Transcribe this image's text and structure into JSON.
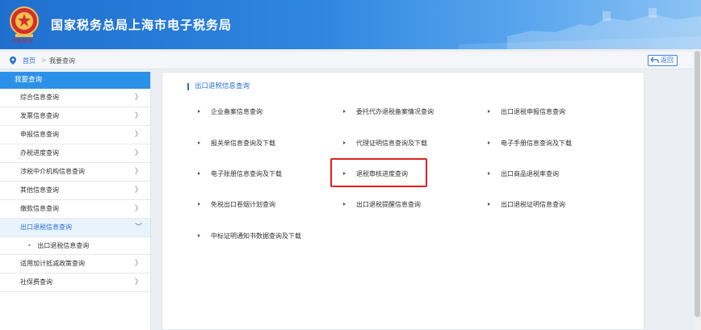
{
  "header": {
    "title": "国家税务总局上海市电子税务局",
    "emblem_text": "中国税务"
  },
  "breadcrumb": {
    "home": "首页",
    "separator": ">",
    "current": "我要查询",
    "back_label": "返回"
  },
  "sidebar": {
    "title": "我要查询",
    "items": [
      {
        "label": "综合信息查询"
      },
      {
        "label": "发票信息查询"
      },
      {
        "label": "申报信息查询"
      },
      {
        "label": "办税进度查询"
      },
      {
        "label": "涉税中介机构信息查询"
      },
      {
        "label": "其他信息查询"
      },
      {
        "label": "缴款信息查询"
      },
      {
        "label": "出口退税信息查询"
      },
      {
        "label": "适用加计抵减政策查询"
      },
      {
        "label": "社保费查询"
      }
    ],
    "sub_item": "出口退税信息查询",
    "chev_closed": "〉",
    "chev_open": "﹀"
  },
  "main": {
    "section_title": "出口退税信息查询",
    "links": [
      "企业备案信息查询",
      "委托代办退税备案情况查询",
      "出口退税申报信息查询",
      "报关单信息查询及下载",
      "代理证明信息查询及下载",
      "电子手册信息查询及下载",
      "电子账册信息查询及下载",
      "退税审核进度查询",
      "出口商品退税率查询",
      "免税出口卷烟计划查询",
      "出口退税提醒信息查询",
      "出口退税证明信息查询",
      "中标证明通知书数据查询及下载"
    ]
  },
  "colors": {
    "header_blue": "#1f6fcf",
    "accent_blue": "#2b91e8",
    "highlight_red": "#e02020"
  }
}
